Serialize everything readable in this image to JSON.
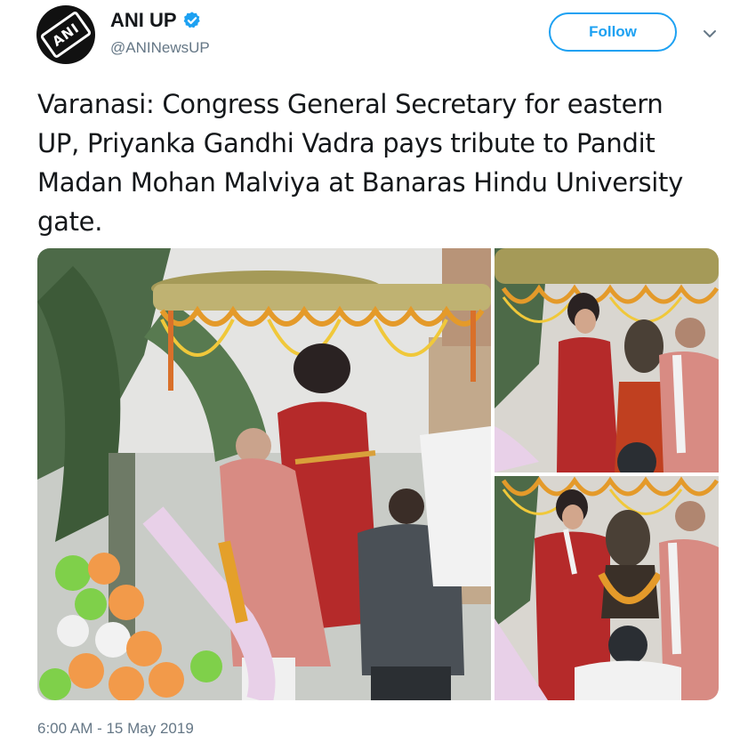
{
  "account": {
    "display_name": "ANI UP",
    "handle": "@ANINewsUP",
    "avatar_logo_text": "ANI",
    "verified": true
  },
  "follow_button": {
    "label": "Follow"
  },
  "menu_icon": "chevron-down-icon",
  "tweet": {
    "text": "Varanasi: Congress General Secretary for eastern UP, Priyanka Gandhi Vadra pays tribute to Pandit Madan Mohan Malviya at Banaras Hindu University gate."
  },
  "media": {
    "photo_count": 3
  },
  "timestamp": "6:00 AM - 15 May 2019",
  "colors": {
    "accent": "#1da1f2",
    "text": "#14171a",
    "secondary_text": "#657786"
  }
}
